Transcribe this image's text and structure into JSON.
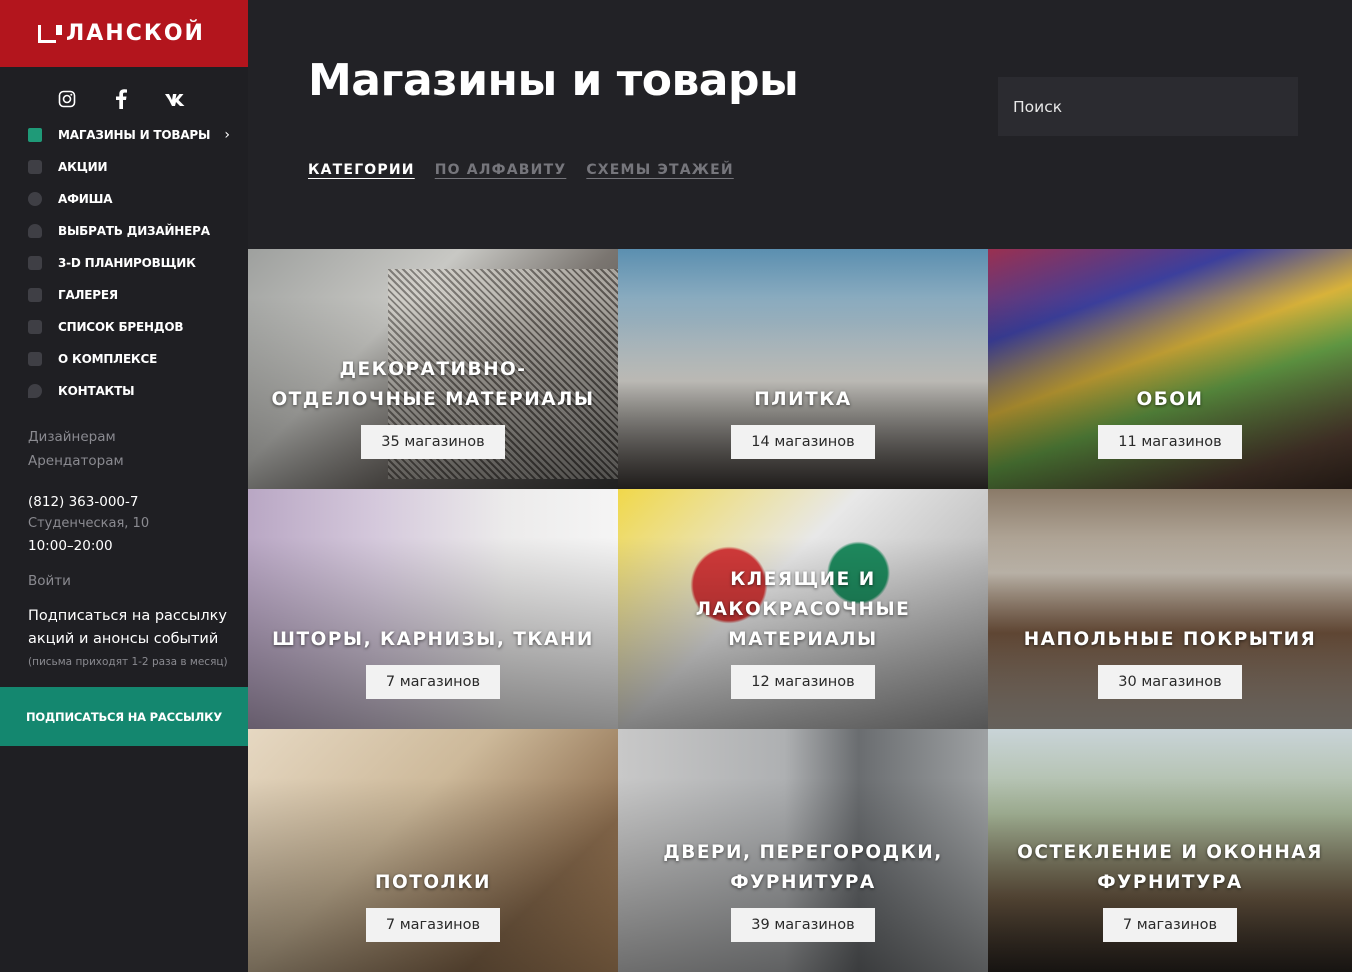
{
  "brand": {
    "name": "ЛАНСКОЙ",
    "color": "#b3151d"
  },
  "socials": [
    "instagram-icon",
    "facebook-icon",
    "vk-icon"
  ],
  "nav": [
    {
      "label": "МАГАЗИНЫ И ТОВАРЫ",
      "icon": "paint-roller-icon",
      "active": true
    },
    {
      "label": "АКЦИИ",
      "icon": "percent-icon"
    },
    {
      "label": "АФИША",
      "icon": "clock-icon"
    },
    {
      "label": "ВЫБРАТЬ ДИЗАЙНЕРА",
      "icon": "lightbulb-icon"
    },
    {
      "label": "3-D ПЛАНИРОВЩИК",
      "icon": "cube-icon"
    },
    {
      "label": "ГАЛЕРЕЯ",
      "icon": "camera-icon"
    },
    {
      "label": "СПИСОК БРЕНДОВ",
      "icon": "list-icon"
    },
    {
      "label": "О КОМПЛЕКСЕ",
      "icon": "building-icon"
    },
    {
      "label": "КОНТАКТЫ",
      "icon": "location-pin-icon"
    }
  ],
  "secondary_links": [
    "Дизайнерам",
    "Арендаторам"
  ],
  "contact": {
    "phone": "(812) 363-000-7",
    "address": "Студенческая, 10",
    "hours": "10:00–20:00"
  },
  "login": "Войти",
  "subscribe": {
    "text": "Подписаться на рассылку акций и анонсы событий",
    "note": "(письма приходят 1-2 раза в месяц)",
    "button": "ПОДПИСАТЬСЯ НА РАССЫЛКУ",
    "button_color": "#14876f"
  },
  "page": {
    "title": "Магазины и товары"
  },
  "search": {
    "placeholder": "Поиск"
  },
  "tabs": [
    {
      "label": "КАТЕГОРИИ",
      "active": true
    },
    {
      "label": "ПО АЛФАВИТУ"
    },
    {
      "label": "СХЕМЫ ЭТАЖЕЙ"
    }
  ],
  "categories": [
    {
      "title": "ДЕКОРАТИВНО-ОТДЕЛОЧНЫЕ МАТЕРИАЛЫ",
      "count": "35 магазинов"
    },
    {
      "title": "ПЛИТКА",
      "count": "14 магазинов"
    },
    {
      "title": "ОБОИ",
      "count": "11 магазинов"
    },
    {
      "title": "ШТОРЫ, КАРНИЗЫ, ТКАНИ",
      "count": "7 магазинов"
    },
    {
      "title": "КЛЕЯЩИЕ И ЛАКОКРАСОЧНЫЕ МАТЕРИАЛЫ",
      "count": "12 магазинов"
    },
    {
      "title": "НАПОЛЬНЫЕ ПОКРЫТИЯ",
      "count": "30 магазинов"
    },
    {
      "title": "ПОТОЛКИ",
      "count": "7 магазинов"
    },
    {
      "title": "ДВЕРИ, ПЕРЕГОРОДКИ, ФУРНИТУРА",
      "count": "39 магазинов"
    },
    {
      "title": "ОСТЕКЛЕНИЕ И ОКОННАЯ ФУРНИТУРА",
      "count": "7 магазинов"
    }
  ]
}
